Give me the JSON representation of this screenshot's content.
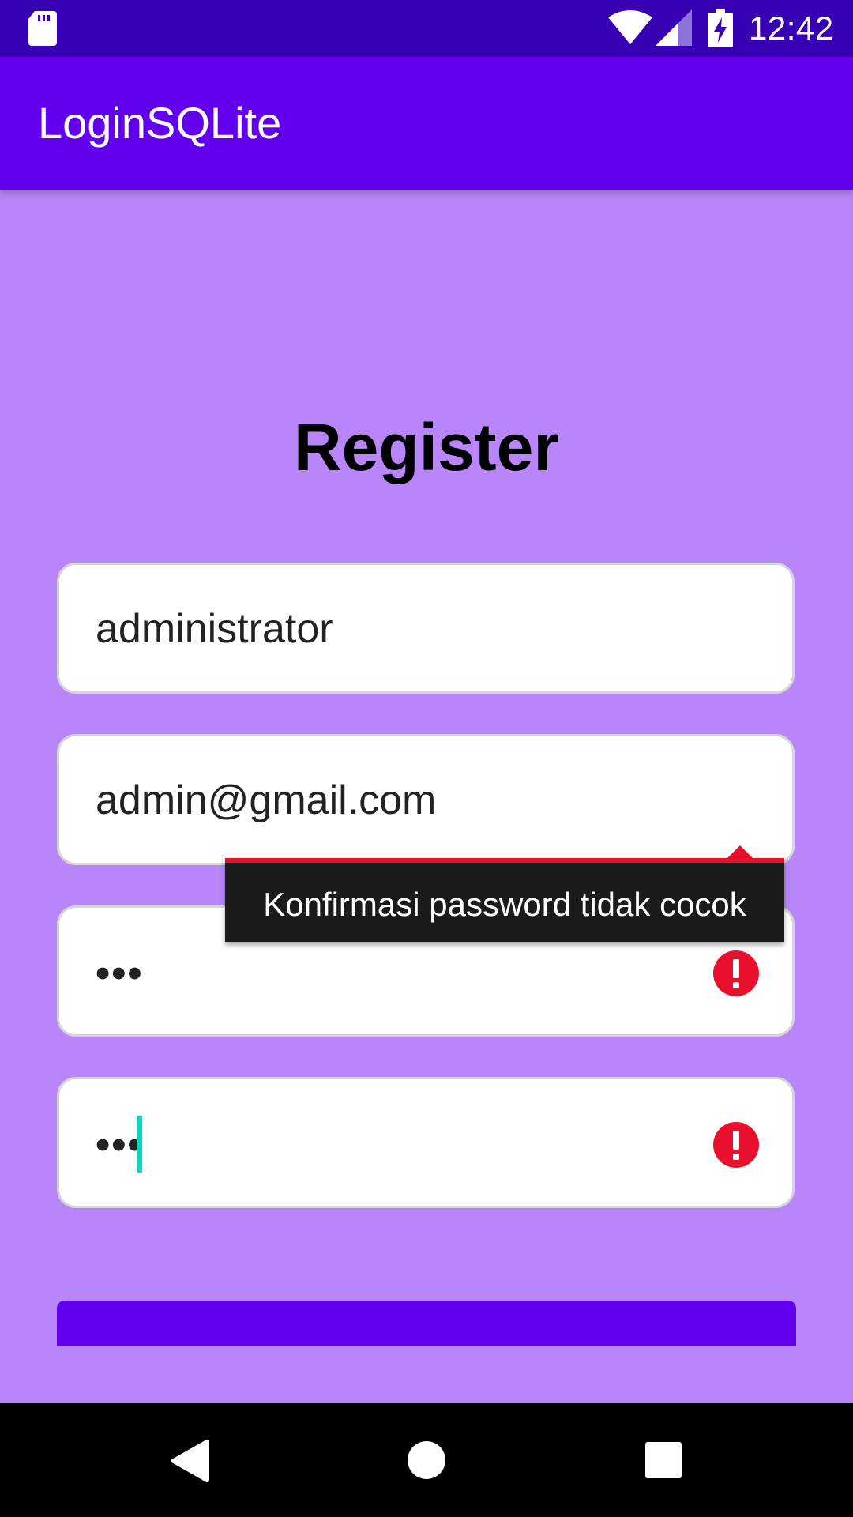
{
  "status_bar": {
    "time": "12:42",
    "icons": [
      "sd-card-icon",
      "wifi-icon",
      "signal-icon",
      "battery-charging-icon"
    ]
  },
  "app_bar": {
    "title": "LoginSQLite"
  },
  "form": {
    "heading": "Register",
    "username_value": "administrator",
    "email_value": "admin@gmail.com",
    "password_value": "•••",
    "confirm_password_value": "•••",
    "error_message": "Konfirmasi password tidak cocok",
    "error_icon": "error-icon"
  },
  "nav_bar": {
    "icons": [
      "back-icon",
      "home-icon",
      "recents-icon"
    ]
  },
  "colors": {
    "status_bar": "#3700b3",
    "app_bar": "#6200ee",
    "background": "#b886f9",
    "error": "#e8102d",
    "cursor": "#03dac5"
  }
}
